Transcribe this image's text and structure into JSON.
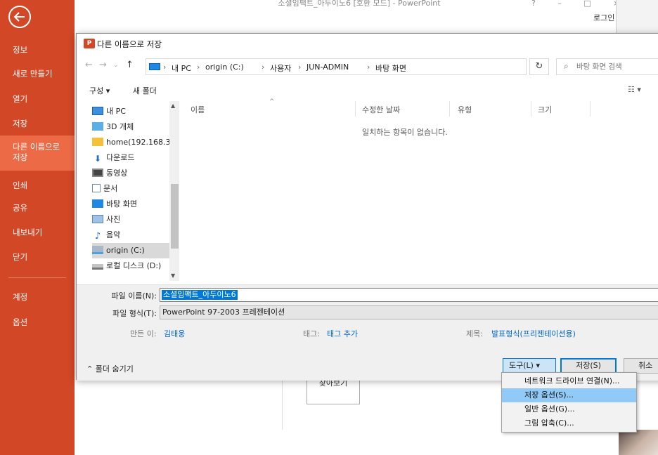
{
  "app": {
    "window_title": "소셜임팩트_아두이노6 [호환 모드] - PowerPoint",
    "window_controls": "?  –  □  ×",
    "login": "로그인"
  },
  "backstage": {
    "items": [
      {
        "label": "정보"
      },
      {
        "label": "새로 만들기"
      },
      {
        "label": "열기"
      },
      {
        "label": "저장"
      },
      {
        "label": "다른 이름으로\n저장"
      },
      {
        "label": "인쇄"
      },
      {
        "label": "공유"
      },
      {
        "label": "내보내기"
      },
      {
        "label": "닫기"
      },
      {
        "label": "계정"
      },
      {
        "label": "옵션"
      }
    ],
    "accent": "#d24726",
    "active_bg": "#ec6b46"
  },
  "background": {
    "browse_button": "찾아보기"
  },
  "dialog": {
    "title": "다른 이름으로 저장",
    "icon_letter": "P",
    "breadcrumb": [
      "내 PC",
      "origin (C:)",
      "사용자",
      "JUN-ADMIN",
      "바탕 화면"
    ],
    "search_placeholder": "바탕 화면 검색",
    "toolbar": {
      "organize": "구성 ▾",
      "new_folder": "새 폴더",
      "view": "☷ ▾"
    },
    "nav_tree": [
      {
        "label": "내 PC",
        "icon": "pc-icon"
      },
      {
        "label": "3D 개체",
        "icon": "cube-icon"
      },
      {
        "label": "home(192.168.3",
        "icon": "network-drive-icon"
      },
      {
        "label": "다운로드",
        "icon": "download-icon"
      },
      {
        "label": "동영상",
        "icon": "video-icon"
      },
      {
        "label": "문서",
        "icon": "document-icon"
      },
      {
        "label": "바탕 화면",
        "icon": "desktop-icon"
      },
      {
        "label": "사진",
        "icon": "pictures-icon"
      },
      {
        "label": "음악",
        "icon": "music-icon"
      },
      {
        "label": "origin (C:)",
        "icon": "drive-c-icon",
        "selected": true
      },
      {
        "label": "로컬 디스크 (D:)",
        "icon": "drive-d-icon"
      }
    ],
    "columns": [
      "이름",
      "수정한 날짜",
      "유형",
      "크기"
    ],
    "empty_message": "일치하는 항목이 없습니다.",
    "form": {
      "filename_label": "파일 이름(N):",
      "filename_value": "소셜임팩트_아두이노6",
      "filetype_label": "파일 형식(T):",
      "filetype_value": "PowerPoint 97-2003 프레젠테이션",
      "author_label": "만든 이:",
      "author_value": "김태웅",
      "tags_label": "태그:",
      "tags_value": "태그 추가",
      "title_label": "제목:",
      "title_value": "발표형식(프리젠테이션용)"
    },
    "hide_folders": "⌃  폴더 숨기기",
    "tools_button": "도구(L)  ▾",
    "save_button": "저장(S)",
    "cancel_button": "취소"
  },
  "tools_menu": {
    "items": [
      {
        "label": "네트워크 드라이브 연결(N)..."
      },
      {
        "label": "저장 옵션(S)...",
        "hover": true
      },
      {
        "label": "일반 옵션(G)..."
      },
      {
        "label": "그림 압축(C)..."
      }
    ]
  }
}
